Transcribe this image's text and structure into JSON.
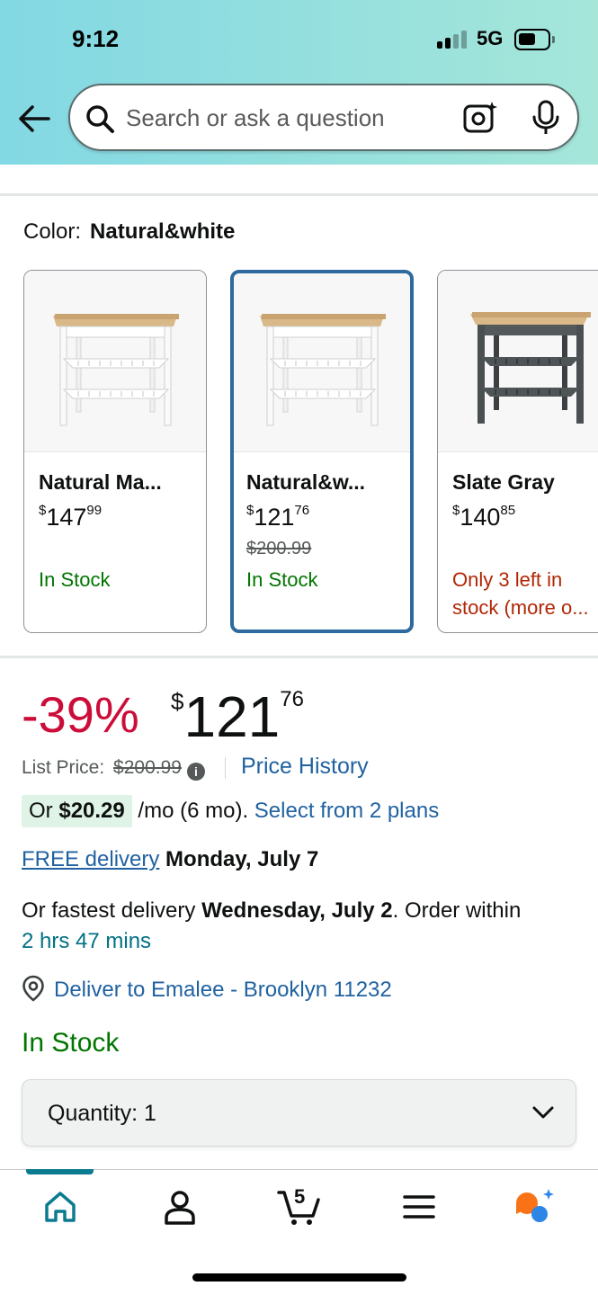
{
  "status_bar": {
    "time": "9:12",
    "network": "5G"
  },
  "search": {
    "placeholder": "Search or ask a question"
  },
  "color_section": {
    "label": "Color:",
    "selected": "Natural&white"
  },
  "swatches": [
    {
      "name": "Natural Ma...",
      "price_whole": "147",
      "price_cents": "99",
      "currency": "$",
      "list_price": "",
      "stock": "In Stock",
      "stock_status": "in",
      "frame_color": "#ffffff"
    },
    {
      "name": "Natural&w...",
      "price_whole": "121",
      "price_cents": "76",
      "currency": "$",
      "list_price": "$200.99",
      "stock": "In Stock",
      "stock_status": "in",
      "frame_color": "#ffffff",
      "selected": true
    },
    {
      "name": "Slate Gray",
      "price_whole": "140",
      "price_cents": "85",
      "currency": "$",
      "list_price": "",
      "stock": "Only 3 left in stock (more o...",
      "stock_status": "low",
      "frame_color": "#4a4f52"
    }
  ],
  "price": {
    "discount": "-39%",
    "currency": "$",
    "whole": "121",
    "cents": "76",
    "list_label": "List Price:",
    "list_price": "$200.99",
    "history_link": "Price History"
  },
  "installment": {
    "prefix": "Or",
    "amount": "$20.29",
    "suffix": "/mo (6 mo).",
    "link": "Select from 2 plans"
  },
  "delivery": {
    "free_link": "FREE delivery",
    "free_date": "Monday, July 7",
    "fastest_prefix": "Or fastest delivery",
    "fastest_date": "Wednesday, July 2",
    "order_within_prefix": ". Order within",
    "order_within": "2 hrs 47 mins",
    "deliver_to": "Deliver to Emalee - Brooklyn 11232"
  },
  "availability": "In Stock",
  "quantity": {
    "label": "Quantity:",
    "value": "1"
  },
  "bottom_nav": {
    "cart_count": "5",
    "items": [
      "home-icon",
      "account-icon",
      "cart-icon",
      "menu-icon",
      "rufus-ai-icon"
    ]
  },
  "colors": {
    "accent_link": "#2162a1",
    "discount_red": "#cc0c39",
    "in_stock_green": "#007600",
    "selected_border": "#2e6a9e"
  }
}
